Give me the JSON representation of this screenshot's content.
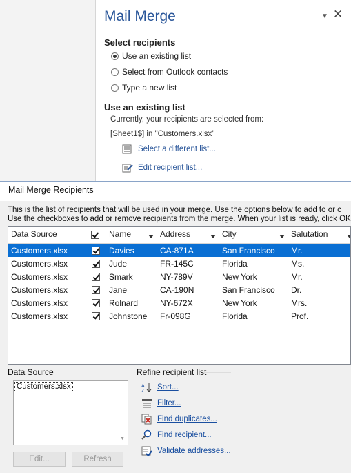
{
  "task_pane": {
    "title": "Mail Merge",
    "select_recipients_heading": "Select recipients",
    "radio_options": [
      {
        "label": "Use an existing list",
        "selected": true
      },
      {
        "label": "Select from Outlook contacts",
        "selected": false
      },
      {
        "label": "Type a new list",
        "selected": false
      }
    ],
    "existing_list_heading": "Use an existing list",
    "current_text": "Currently, your recipients are selected from:",
    "source_text": "[Sheet1$] in \"Customers.xlsx\"",
    "select_different_link": "Select a different list...",
    "edit_recipient_link": "Edit recipient list..."
  },
  "dialog": {
    "title": "Mail Merge Recipients",
    "instructions_line1": "This is the list of recipients that will be used in your merge.  Use the options below to add to or c",
    "instructions_line2": "Use the checkboxes to add or remove recipients from the merge.  When your list is ready, click OK",
    "columns": [
      "Data Source",
      "",
      "Name",
      "Address",
      "City",
      "Salutation"
    ],
    "rows": [
      {
        "source": "Customers.xlsx",
        "checked": true,
        "name": "Davies",
        "address": "CA-871A",
        "city": "San Francisco",
        "salutation": "Mr.",
        "selected": true
      },
      {
        "source": "Customers.xlsx",
        "checked": true,
        "name": "Jude",
        "address": "FR-145C",
        "city": "Florida",
        "salutation": "Ms.",
        "selected": false
      },
      {
        "source": "Customers.xlsx",
        "checked": true,
        "name": "Smark",
        "address": "NY-789V",
        "city": "New York",
        "salutation": "Mr.",
        "selected": false
      },
      {
        "source": "Customers.xlsx",
        "checked": true,
        "name": "Jane",
        "address": "CA-190N",
        "city": "San Francisco",
        "salutation": "Dr.",
        "selected": false
      },
      {
        "source": "Customers.xlsx",
        "checked": true,
        "name": "Rolnard",
        "address": "NY-672X",
        "city": "New York",
        "salutation": "Mrs.",
        "selected": false
      },
      {
        "source": "Customers.xlsx",
        "checked": true,
        "name": "Johnstone",
        "address": "Fr-098G",
        "city": "Florida",
        "salutation": "Prof.",
        "selected": false
      }
    ],
    "data_source_label": "Data Source",
    "data_source_items": [
      "Customers.xlsx"
    ],
    "edit_button": "Edit...",
    "refresh_button": "Refresh",
    "refine_label": "Refine recipient list",
    "refine_links": [
      {
        "label": "Sort...",
        "icon": "sort-icon"
      },
      {
        "label": "Filter...",
        "icon": "filter-icon"
      },
      {
        "label": "Find duplicates...",
        "icon": "find-duplicates-icon"
      },
      {
        "label": "Find recipient...",
        "icon": "find-recipient-icon"
      },
      {
        "label": "Validate addresses...",
        "icon": "validate-addresses-icon"
      }
    ]
  },
  "colors": {
    "accent": "#2b579a",
    "selection": "#0a6fd3",
    "link": "#1a4fa0"
  }
}
